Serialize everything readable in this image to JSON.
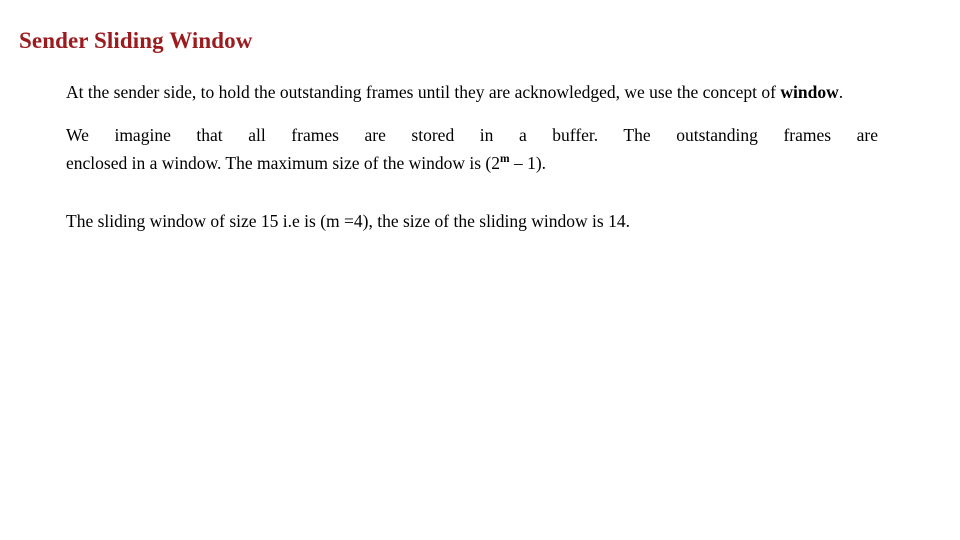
{
  "slide": {
    "title": "Sender Sliding Window",
    "title_color": "#9B1B1E",
    "background_color": "#FFFFFF",
    "paragraphs": [
      {
        "id": "paragraph-1",
        "segments": {
          "text_before_bold": "At the sender side, to hold the outstanding frames until they are acknowledged, we use the concept of ",
          "bold_word": "window",
          "text_after_bold": "."
        }
      },
      {
        "id": "paragraph-2",
        "segments": {
          "line1": "We imagine that all frames are stored in a buffer. The outstanding frames are",
          "line2_before_sup": "enclosed in a window. The maximum size of the window is (2",
          "superscript": "m",
          "line2_after_sup": " – 1)."
        }
      },
      {
        "id": "paragraph-3",
        "segments": {
          "text": "The sliding window of size 15 i.e is (m =4), the size of the sliding window is 14."
        }
      }
    ]
  }
}
